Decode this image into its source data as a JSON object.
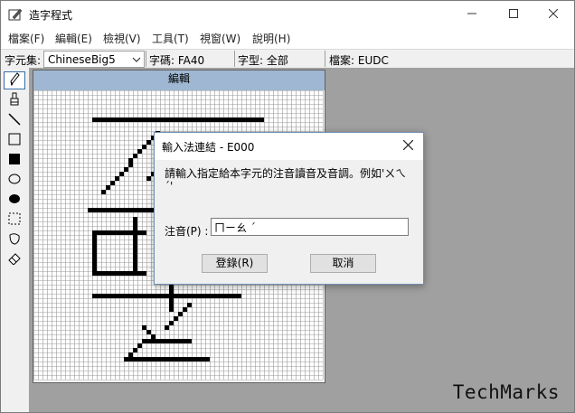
{
  "window": {
    "title": "造字程式"
  },
  "menu": [
    {
      "label": "檔案(F)"
    },
    {
      "label": "編輯(E)"
    },
    {
      "label": "檢視(V)"
    },
    {
      "label": "工具(T)"
    },
    {
      "label": "視窗(W)"
    },
    {
      "label": "說明(H)"
    }
  ],
  "statusbar": {
    "charset_label": "字元集:",
    "charset_value": "ChineseBig5",
    "code_text": "字碼: FA40",
    "font_text": "字型: 全部",
    "file_text": "檔案: EUDC"
  },
  "tools": [
    {
      "icon": "pencil-icon"
    },
    {
      "icon": "brush-icon"
    },
    {
      "icon": "line-icon"
    },
    {
      "icon": "hollow-rectangle-icon"
    },
    {
      "icon": "filled-rectangle-icon"
    },
    {
      "icon": "hollow-ellipse-icon"
    },
    {
      "icon": "filled-ellipse-icon"
    },
    {
      "icon": "rectangular-selection-icon"
    },
    {
      "icon": "freeform-selection-icon"
    },
    {
      "icon": "eraser-icon"
    }
  ],
  "editor": {
    "header": "編輯"
  },
  "dialog": {
    "title": "輸入法連結 - E000",
    "message": "請輸入指定給本字元的注音讀音及音調。例如'ㄨㄟ ˊ'",
    "field_label": "注音(P) :",
    "field_value": "ㄇㄧㄠ ˊ",
    "ok_label": "登錄(R)",
    "cancel_label": "取消"
  },
  "watermark": "TechMarks",
  "colors": {
    "editor_header": "#9fb7d2",
    "workspace": "#a0a0a0",
    "accent": "#3a6ea5"
  }
}
